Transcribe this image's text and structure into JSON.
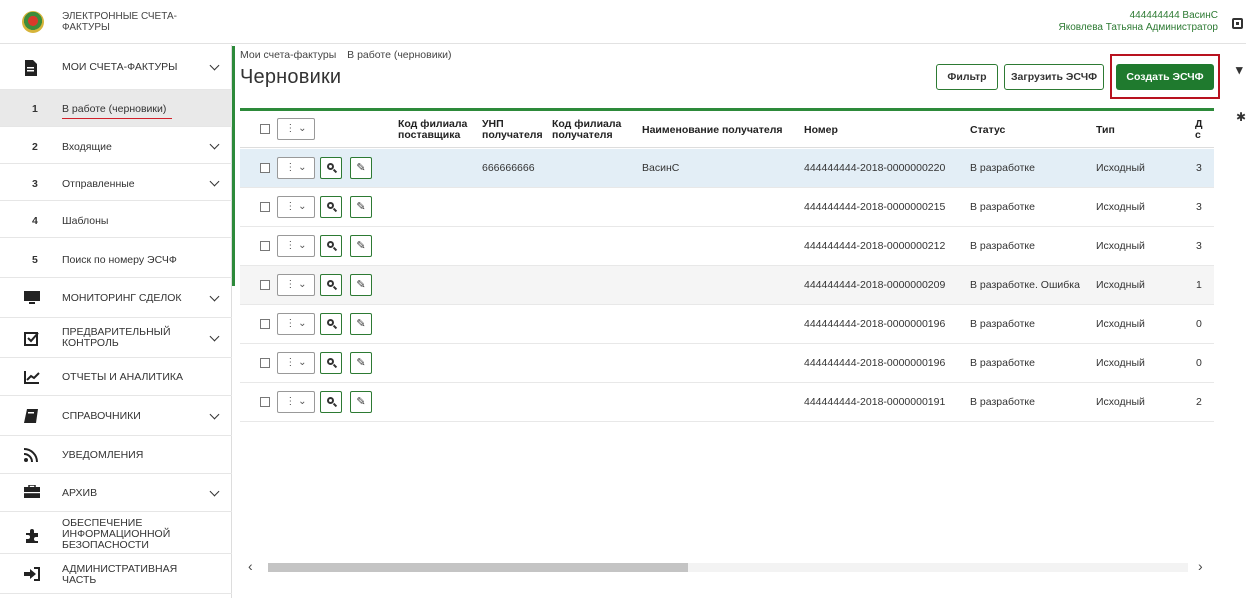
{
  "app": {
    "title": "ЭЛЕКТРОННЫЕ СЧЕТА-ФАКТУРЫ"
  },
  "user": {
    "id_name": "444444444 ВасинС",
    "full_name": "Яковлева Татьяна Администратор"
  },
  "sidebar": {
    "sections": [
      {
        "label": "МОИ СЧЕТА-ФАКТУРЫ",
        "icon": "document-icon",
        "expandable": true
      },
      {
        "label": "МОНИТОРИНГ СДЕЛОК",
        "icon": "monitor-icon",
        "expandable": true
      },
      {
        "label": "ПРЕДВАРИТЕЛЬНЫЙ КОНТРОЛЬ",
        "icon": "checkbox-icon",
        "expandable": true
      },
      {
        "label": "ОТЧЕТЫ И АНАЛИТИКА",
        "icon": "chart-line-icon",
        "expandable": false
      },
      {
        "label": "СПРАВОЧНИКИ",
        "icon": "book-icon",
        "expandable": true
      },
      {
        "label": "УВЕДОМЛЕНИЯ",
        "icon": "rss-icon",
        "expandable": false
      },
      {
        "label": "АРХИВ",
        "icon": "archive-icon",
        "expandable": true
      },
      {
        "label": "ОБЕСПЕЧЕНИЕ ИНФОРМАЦИОННОЙ БЕЗОПАСНОСТИ",
        "icon": "puzzle-icon",
        "expandable": false
      },
      {
        "label": "АДМИНИСТРАТИВНАЯ ЧАСТЬ",
        "icon": "sign-in-icon",
        "expandable": false
      }
    ],
    "subitems": [
      {
        "num": "1",
        "label": "В работе (черновики)",
        "active": true
      },
      {
        "num": "2",
        "label": "Входящие",
        "expandable": true
      },
      {
        "num": "3",
        "label": "Отправленные",
        "expandable": true
      },
      {
        "num": "4",
        "label": "Шаблоны"
      },
      {
        "num": "5",
        "label": "Поиск по номеру ЭСЧФ"
      }
    ]
  },
  "breadcrumb": [
    "Мои счета-фактуры",
    "В работе (черновики)"
  ],
  "page_title": "Черновики",
  "toolbar": {
    "filter": "Фильтр",
    "upload": "Загрузить ЭСЧФ",
    "create": "Создать ЭСЧФ"
  },
  "table": {
    "columns": [
      "Код филиала поставщика",
      "УНП получателя",
      "Код филиала получателя",
      "Наименование получателя",
      "Номер",
      "Статус",
      "Тип",
      "Д с"
    ],
    "rows": [
      {
        "unp": "666666666",
        "recipient": "ВасинС",
        "number": "444444444-2018-0000000220",
        "status": "В разработке",
        "type": "Исходный",
        "extra": "3"
      },
      {
        "unp": "",
        "recipient": "",
        "number": "444444444-2018-0000000215",
        "status": "В разработке",
        "type": "Исходный",
        "extra": "3"
      },
      {
        "unp": "",
        "recipient": "",
        "number": "444444444-2018-0000000212",
        "status": "В разработке",
        "type": "Исходный",
        "extra": "3"
      },
      {
        "unp": "",
        "recipient": "",
        "number": "444444444-2018-0000000209",
        "status": "В разработке. Ошибка",
        "type": "Исходный",
        "extra": "1"
      },
      {
        "unp": "",
        "recipient": "",
        "number": "444444444-2018-0000000196",
        "status": "В разработке",
        "type": "Исходный",
        "extra": "0"
      },
      {
        "unp": "",
        "recipient": "",
        "number": "444444444-2018-0000000196",
        "status": "В разработке",
        "type": "Исходный",
        "extra": "0"
      },
      {
        "unp": "",
        "recipient": "",
        "number": "444444444-2018-0000000191",
        "status": "В разработке",
        "type": "Исходный",
        "extra": "2"
      }
    ]
  },
  "colors": {
    "accent_green": "#1f7a2e",
    "highlight_red": "#b8121f",
    "active_underline": "#d0202a"
  }
}
